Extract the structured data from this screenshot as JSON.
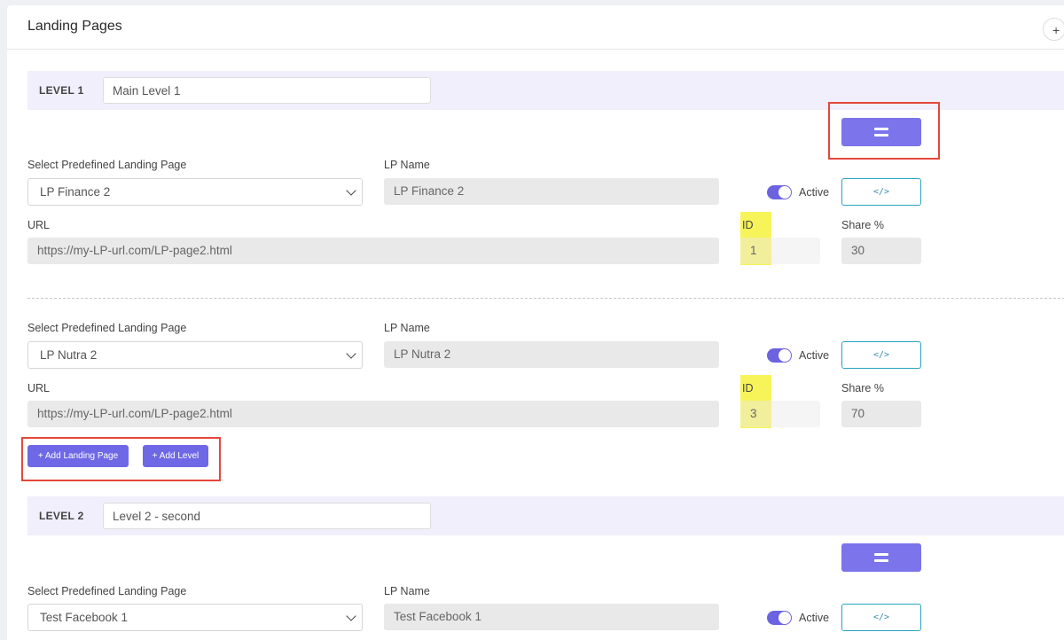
{
  "page": {
    "title": "Landing Pages",
    "header_button_glyph": "+"
  },
  "level1": {
    "label": "LEVEL 1",
    "name_value": "Main Level 1",
    "landing_pages": [
      {
        "select_label": "Select Predefined Landing Page",
        "selected": "LP Finance 2",
        "lp_name_label": "LP Name",
        "lp_name": "LP Finance 2",
        "active_label": "Active",
        "url_label": "URL",
        "url": "https://my-LP-url.com/LP-page2.html",
        "id_label": "ID",
        "id": "1",
        "share_label": "Share %",
        "share": "30",
        "code_glyph": "</>"
      },
      {
        "select_label": "Select Predefined Landing Page",
        "selected": "LP Nutra 2",
        "lp_name_label": "LP Name",
        "lp_name": "LP Nutra 2",
        "active_label": "Active",
        "url_label": "URL",
        "url": "https://my-LP-url.com/LP-page2.html",
        "id_label": "ID",
        "id": "3",
        "share_label": "Share %",
        "share": "70",
        "code_glyph": "</>"
      }
    ],
    "add_landing_page_label": "+ Add Landing Page",
    "add_level_label": "+ Add Level"
  },
  "level2": {
    "label": "LEVEL 2",
    "name_value": "Level 2 - second",
    "landing_pages": [
      {
        "select_label": "Select Predefined Landing Page",
        "selected": "Test Facebook 1",
        "lp_name_label": "LP Name",
        "lp_name": "Test Facebook 1",
        "active_label": "Active",
        "code_glyph": "</>"
      }
    ]
  },
  "colors": {
    "accent": "#7b74ea",
    "highlight": "#f7f45a",
    "annotation": "#e4473c",
    "level_bar": "#f0effb"
  }
}
